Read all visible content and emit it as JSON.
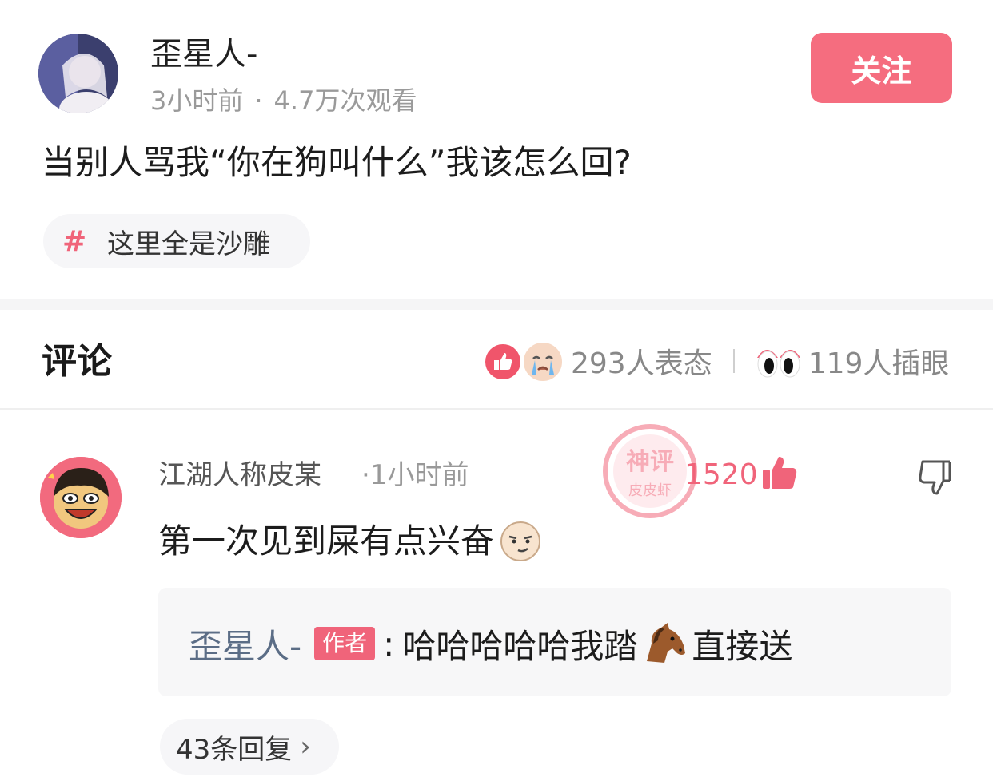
{
  "post": {
    "author": "歪星人-",
    "time_ago": "3小时前",
    "views": "4.7万次观看",
    "meta_separator": "·",
    "follow_label": "关注",
    "title": "当别人骂我“你在狗叫什么”我该怎么回?",
    "topic_hash": "#",
    "topic": "这里全是沙雕"
  },
  "comments_header": {
    "title": "评论",
    "reactions_count": "293人表态",
    "eyes_count": "119人插眼"
  },
  "comment": {
    "username": "江湖人称皮某",
    "time_ago": "·1小时前",
    "like_count": "1520",
    "text": "第一次见到屎有点兴奋",
    "stamp_text_top": "神评",
    "stamp_text_bottom": "皮皮虾"
  },
  "reply": {
    "author": "歪星人-",
    "badge": "作者",
    "colon": ":",
    "text_before": "哈哈哈哈哈我踏",
    "text_after": "直接送",
    "reply_count_label": "43条回复",
    "chevron": "›"
  },
  "colors": {
    "accent": "#f56d7f",
    "author_link": "#5b6d86"
  }
}
